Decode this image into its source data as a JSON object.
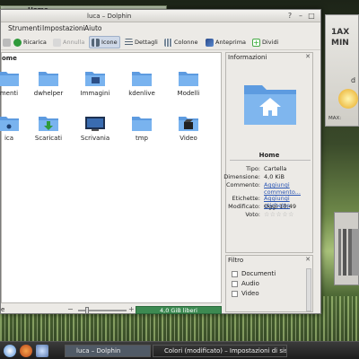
{
  "background_window": {
    "title": "Home"
  },
  "window": {
    "title": "luca – Dolphin"
  },
  "menubar": {
    "items": [
      "Strumenti",
      "Impostazioni",
      "Aiuto"
    ]
  },
  "toolbar": {
    "ricarica": "Ricarica",
    "annulla": "Annulla",
    "icone": "Icone",
    "dettagli": "Dettagli",
    "colonne": "Colonne",
    "anteprima": "Anteprima",
    "dividi": "Dividi"
  },
  "location": {
    "label": "ome"
  },
  "files": [
    {
      "name": "menti",
      "kind": "folder"
    },
    {
      "name": "dwhelper",
      "kind": "folder"
    },
    {
      "name": "Immagini",
      "kind": "folder-pictures"
    },
    {
      "name": "kdenlive",
      "kind": "folder"
    },
    {
      "name": "Modelli",
      "kind": "folder"
    },
    {
      "name": "ica",
      "kind": "folder-music"
    },
    {
      "name": "Scaricati",
      "kind": "folder-downloads"
    },
    {
      "name": "Scrivania",
      "kind": "folder-desktop"
    },
    {
      "name": "tmp",
      "kind": "folder"
    },
    {
      "name": "Video",
      "kind": "folder-video"
    }
  ],
  "statusbar": {
    "left": "e",
    "free_space": "4,0 GiB liberi",
    "free_space_fraction": 0.35
  },
  "info_panel": {
    "title": "Informazioni",
    "name": "Home",
    "rows": {
      "tipo_label": "Tipo:",
      "tipo": "Cartella",
      "dimensione_label": "Dimensione:",
      "dimensione": "4,0 KiB",
      "commento_label": "Commento:",
      "commento": "Aggiungi commento...",
      "etichette_label": "Etichette:",
      "etichette": "Aggiungi etichette",
      "modificato_label": "Modificato:",
      "modificato": "Oggi 10:49",
      "voto_label": "Voto:",
      "voto": "☆☆☆☆☆"
    }
  },
  "filter_panel": {
    "title": "Filtro",
    "options": [
      "Documenti",
      "Audio",
      "Video"
    ]
  },
  "weather_widget": {
    "line1": "1AX",
    "line2": "MIN",
    "line3": "d",
    "line4": "MAX:",
    "line5": "MI"
  },
  "taskbar": {
    "tasks": [
      "luca – Dolphin",
      "Colori (modificato) – Impostazioni di sis"
    ]
  },
  "colors": {
    "folder_blue": "#5d9be0",
    "accent_green": "#3d8a52",
    "link": "#2b56b4"
  }
}
